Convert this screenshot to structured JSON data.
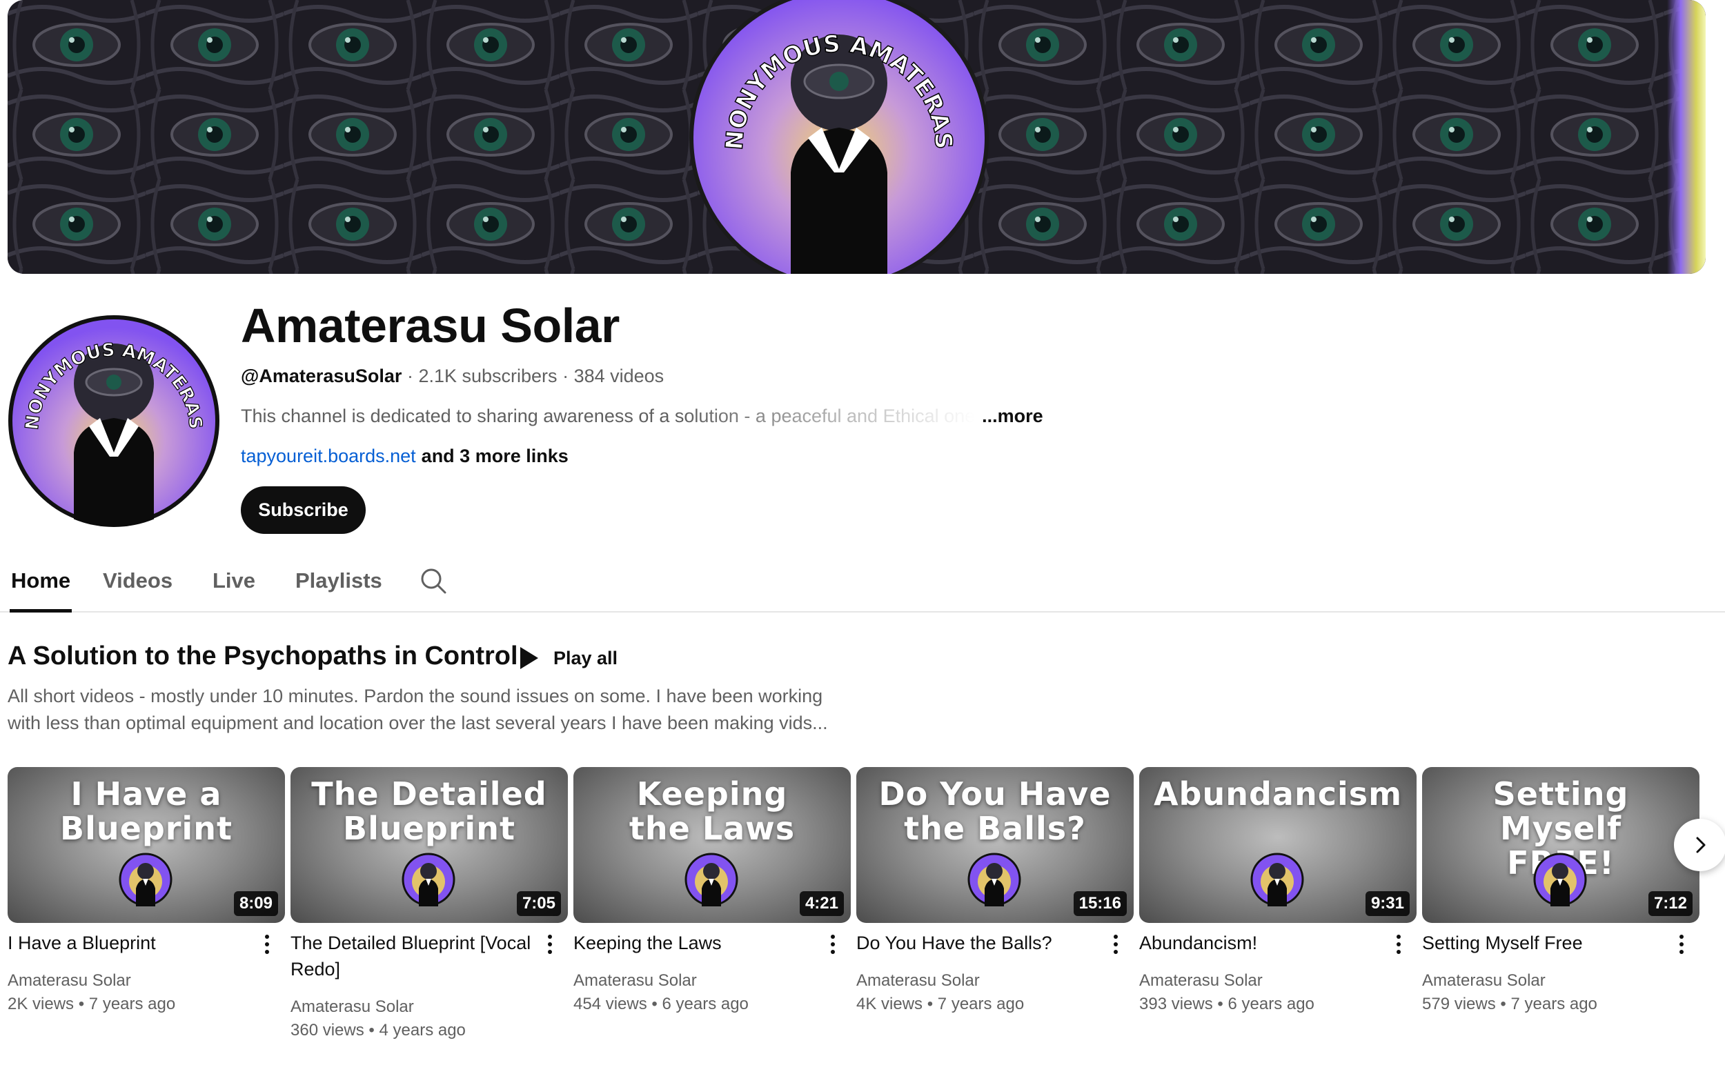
{
  "banner": {
    "arc_text": "ANONYMOUS AMATERASU",
    "colors": {
      "purple": "#8b62f0",
      "glow": "#e8c96a",
      "dark": "#1b1a22"
    }
  },
  "channel": {
    "name": "Amaterasu Solar",
    "handle": "@AmaterasuSolar",
    "subscribers": "2.1K subscribers",
    "videos": "384 videos",
    "description": "This channel is dedicated to sharing awareness of a solution - a peaceful and Ethical one",
    "description_more": "...more",
    "link": "tapyoureit.boards.net",
    "more_links": "and 3 more links",
    "subscribe_label": "Subscribe",
    "avatar_arc_text": "ANONYMOUS AMATERASU"
  },
  "tabs": [
    {
      "label": "Home",
      "active": true
    },
    {
      "label": "Videos",
      "active": false
    },
    {
      "label": "Live",
      "active": false
    },
    {
      "label": "Playlists",
      "active": false
    }
  ],
  "tab_search_icon": "search-icon",
  "shelf": {
    "title": "A Solution to the Psychopaths in Control",
    "play_all": "Play all",
    "description": "All short videos - mostly under 10 minutes. Pardon the sound issues on some. I have been working with less than optimal equipment and location over the last several years I have been making vids..."
  },
  "videos": [
    {
      "thumb_text": "I Have a\nBlueprint",
      "duration": "8:09",
      "title": "I Have a Blueprint",
      "channel": "Amaterasu Solar",
      "views": "2K views",
      "age": "7 years ago"
    },
    {
      "thumb_text": "The Detailed\nBlueprint",
      "duration": "7:05",
      "title": "The Detailed Blueprint [Vocal Redo]",
      "channel": "Amaterasu Solar",
      "views": "360 views",
      "age": "4 years ago"
    },
    {
      "thumb_text": "Keeping\nthe Laws",
      "duration": "4:21",
      "title": "Keeping the Laws",
      "channel": "Amaterasu Solar",
      "views": "454 views",
      "age": "6 years ago"
    },
    {
      "thumb_text": "Do You Have\nthe Balls?",
      "duration": "15:16",
      "title": "Do You Have the Balls?",
      "channel": "Amaterasu Solar",
      "views": "4K views",
      "age": "7 years ago"
    },
    {
      "thumb_text": "Abundancism",
      "duration": "9:31",
      "title": "Abundancism!",
      "channel": "Amaterasu Solar",
      "views": "393 views",
      "age": "6 years ago"
    },
    {
      "thumb_text": "Setting Myself\nFREE!",
      "duration": "7:12",
      "title": "Setting Myself Free",
      "channel": "Amaterasu Solar",
      "views": "579 views",
      "age": "7 years ago"
    }
  ],
  "separator": "•",
  "meta_separator": "·",
  "next_icon": "chevron-right-icon"
}
